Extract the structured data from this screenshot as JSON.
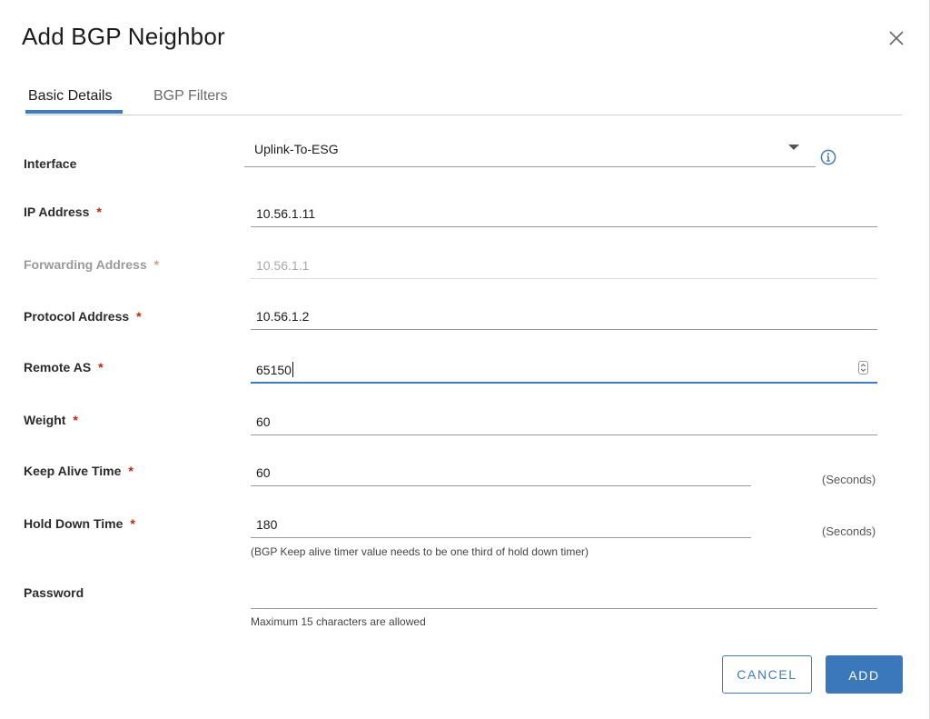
{
  "dialog": {
    "title": "Add BGP Neighbor"
  },
  "tabs": [
    {
      "label": "Basic Details",
      "active": true
    },
    {
      "label": "BGP Filters",
      "active": false
    }
  ],
  "form": {
    "interface": {
      "label": "Interface",
      "value": "Uplink-To-ESG"
    },
    "ip_address": {
      "label": "IP Address",
      "required": "*",
      "value": "10.56.1.11"
    },
    "forwarding_address": {
      "label": "Forwarding Address",
      "required": "*",
      "value": "10.56.1.1",
      "disabled": true
    },
    "protocol_address": {
      "label": "Protocol Address",
      "required": "*",
      "value": "10.56.1.2"
    },
    "remote_as": {
      "label": "Remote AS",
      "required": "*",
      "value": "65150"
    },
    "weight": {
      "label": "Weight",
      "required": "*",
      "value": "60"
    },
    "keep_alive_time": {
      "label": "Keep Alive Time",
      "required": "*",
      "value": "60",
      "unit": "(Seconds)"
    },
    "hold_down_time": {
      "label": "Hold Down Time",
      "required": "*",
      "value": "180",
      "unit": "(Seconds)",
      "help": "(BGP Keep alive timer value needs to be one third of hold down timer)"
    },
    "password": {
      "label": "Password",
      "value": "",
      "help": "Maximum 15 characters are allowed"
    }
  },
  "buttons": {
    "cancel": "CANCEL",
    "add": "ADD"
  },
  "icons": {
    "close": "close-icon",
    "info": "info-icon",
    "dropdown": "chevron-down-icon",
    "stepper": "stepper-icon"
  },
  "colors": {
    "accent": "#3d7bc7",
    "primary_button": "#3b78bb",
    "required": "#c92100"
  }
}
